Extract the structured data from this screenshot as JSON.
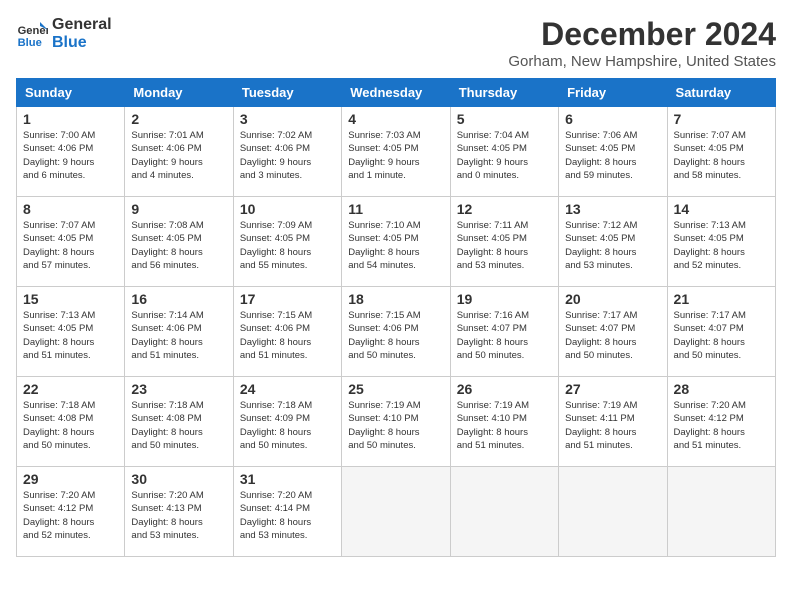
{
  "logo": {
    "line1": "General",
    "line2": "Blue"
  },
  "title": "December 2024",
  "subtitle": "Gorham, New Hampshire, United States",
  "days_of_week": [
    "Sunday",
    "Monday",
    "Tuesday",
    "Wednesday",
    "Thursday",
    "Friday",
    "Saturday"
  ],
  "weeks": [
    [
      {
        "day": 1,
        "info": "Sunrise: 7:00 AM\nSunset: 4:06 PM\nDaylight: 9 hours\nand 6 minutes."
      },
      {
        "day": 2,
        "info": "Sunrise: 7:01 AM\nSunset: 4:06 PM\nDaylight: 9 hours\nand 4 minutes."
      },
      {
        "day": 3,
        "info": "Sunrise: 7:02 AM\nSunset: 4:06 PM\nDaylight: 9 hours\nand 3 minutes."
      },
      {
        "day": 4,
        "info": "Sunrise: 7:03 AM\nSunset: 4:05 PM\nDaylight: 9 hours\nand 1 minute."
      },
      {
        "day": 5,
        "info": "Sunrise: 7:04 AM\nSunset: 4:05 PM\nDaylight: 9 hours\nand 0 minutes."
      },
      {
        "day": 6,
        "info": "Sunrise: 7:06 AM\nSunset: 4:05 PM\nDaylight: 8 hours\nand 59 minutes."
      },
      {
        "day": 7,
        "info": "Sunrise: 7:07 AM\nSunset: 4:05 PM\nDaylight: 8 hours\nand 58 minutes."
      }
    ],
    [
      {
        "day": 8,
        "info": "Sunrise: 7:07 AM\nSunset: 4:05 PM\nDaylight: 8 hours\nand 57 minutes."
      },
      {
        "day": 9,
        "info": "Sunrise: 7:08 AM\nSunset: 4:05 PM\nDaylight: 8 hours\nand 56 minutes."
      },
      {
        "day": 10,
        "info": "Sunrise: 7:09 AM\nSunset: 4:05 PM\nDaylight: 8 hours\nand 55 minutes."
      },
      {
        "day": 11,
        "info": "Sunrise: 7:10 AM\nSunset: 4:05 PM\nDaylight: 8 hours\nand 54 minutes."
      },
      {
        "day": 12,
        "info": "Sunrise: 7:11 AM\nSunset: 4:05 PM\nDaylight: 8 hours\nand 53 minutes."
      },
      {
        "day": 13,
        "info": "Sunrise: 7:12 AM\nSunset: 4:05 PM\nDaylight: 8 hours\nand 53 minutes."
      },
      {
        "day": 14,
        "info": "Sunrise: 7:13 AM\nSunset: 4:05 PM\nDaylight: 8 hours\nand 52 minutes."
      }
    ],
    [
      {
        "day": 15,
        "info": "Sunrise: 7:13 AM\nSunset: 4:05 PM\nDaylight: 8 hours\nand 51 minutes."
      },
      {
        "day": 16,
        "info": "Sunrise: 7:14 AM\nSunset: 4:06 PM\nDaylight: 8 hours\nand 51 minutes."
      },
      {
        "day": 17,
        "info": "Sunrise: 7:15 AM\nSunset: 4:06 PM\nDaylight: 8 hours\nand 51 minutes."
      },
      {
        "day": 18,
        "info": "Sunrise: 7:15 AM\nSunset: 4:06 PM\nDaylight: 8 hours\nand 50 minutes."
      },
      {
        "day": 19,
        "info": "Sunrise: 7:16 AM\nSunset: 4:07 PM\nDaylight: 8 hours\nand 50 minutes."
      },
      {
        "day": 20,
        "info": "Sunrise: 7:17 AM\nSunset: 4:07 PM\nDaylight: 8 hours\nand 50 minutes."
      },
      {
        "day": 21,
        "info": "Sunrise: 7:17 AM\nSunset: 4:07 PM\nDaylight: 8 hours\nand 50 minutes."
      }
    ],
    [
      {
        "day": 22,
        "info": "Sunrise: 7:18 AM\nSunset: 4:08 PM\nDaylight: 8 hours\nand 50 minutes."
      },
      {
        "day": 23,
        "info": "Sunrise: 7:18 AM\nSunset: 4:08 PM\nDaylight: 8 hours\nand 50 minutes."
      },
      {
        "day": 24,
        "info": "Sunrise: 7:18 AM\nSunset: 4:09 PM\nDaylight: 8 hours\nand 50 minutes."
      },
      {
        "day": 25,
        "info": "Sunrise: 7:19 AM\nSunset: 4:10 PM\nDaylight: 8 hours\nand 50 minutes."
      },
      {
        "day": 26,
        "info": "Sunrise: 7:19 AM\nSunset: 4:10 PM\nDaylight: 8 hours\nand 51 minutes."
      },
      {
        "day": 27,
        "info": "Sunrise: 7:19 AM\nSunset: 4:11 PM\nDaylight: 8 hours\nand 51 minutes."
      },
      {
        "day": 28,
        "info": "Sunrise: 7:20 AM\nSunset: 4:12 PM\nDaylight: 8 hours\nand 51 minutes."
      }
    ],
    [
      {
        "day": 29,
        "info": "Sunrise: 7:20 AM\nSunset: 4:12 PM\nDaylight: 8 hours\nand 52 minutes."
      },
      {
        "day": 30,
        "info": "Sunrise: 7:20 AM\nSunset: 4:13 PM\nDaylight: 8 hours\nand 53 minutes."
      },
      {
        "day": 31,
        "info": "Sunrise: 7:20 AM\nSunset: 4:14 PM\nDaylight: 8 hours\nand 53 minutes."
      },
      null,
      null,
      null,
      null
    ]
  ]
}
